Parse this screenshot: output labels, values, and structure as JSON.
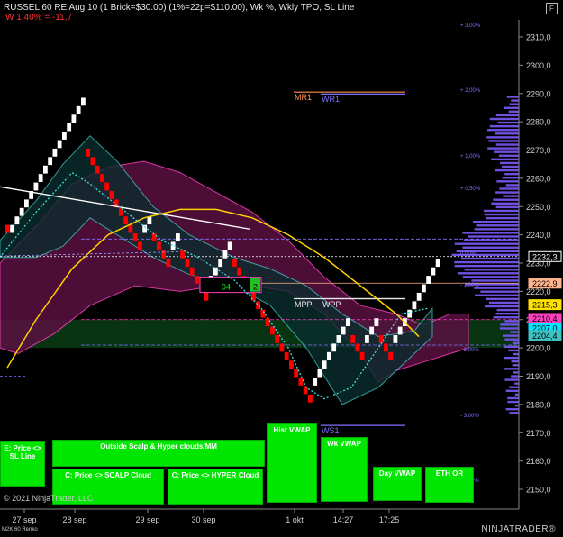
{
  "header": {
    "title": "RUSSEL 60 RE Aug 10 (1 Brick=$30.00) (1%=22p=$110.00), Wk %, Wkly TPO, SL Line",
    "subtitle": "W 1,40% = -11,7"
  },
  "copyright": "© 2021 NinjaTrader, LLC",
  "footer_left": "M2K 60 Renko",
  "brand": "NINJATRADER®",
  "colors": {
    "background": "#000000",
    "brick_up": "#ffffff",
    "brick_down": "#ff0000",
    "brick_neutral": "#a0a0a0",
    "vwap_curve": "#ffd000",
    "cloud_pink": "#ff40c0",
    "cloud_teal": "#40c0c0",
    "profile": "#7050e0",
    "button": "#00e600"
  },
  "chart_data": {
    "type": "renko",
    "y_axis": {
      "range": [
        2165,
        2316
      ],
      "ticks": [
        2150,
        2160,
        2170,
        2180,
        2190,
        2200,
        2210,
        2220,
        2230,
        2240,
        2250,
        2260,
        2270,
        2280,
        2290,
        2300,
        2310
      ],
      "tick_labels": [
        "2150,0",
        "2160,0",
        "2170,0",
        "2180,0",
        "2190,0",
        "2200,0",
        "2210,0",
        "2220,0",
        "2230,0",
        "2240,0",
        "2250,0",
        "2260,0",
        "2270,0",
        "2280,0",
        "2290,0",
        "2300,0",
        "2310,0"
      ]
    },
    "x_axis": {
      "tick_labels": [
        "27 sep",
        "28 sep",
        "29 sep",
        "30 sep",
        "1 okt",
        "14:27",
        "17:25"
      ]
    },
    "bricks": [
      {
        "dir": "down",
        "close": 2240.5
      },
      {
        "dir": "up",
        "close": 2243.5
      },
      {
        "dir": "up",
        "close": 2246.5
      },
      {
        "dir": "up",
        "close": 2249.5
      },
      {
        "dir": "up",
        "close": 2252.5
      },
      {
        "dir": "up",
        "close": 2255.5
      },
      {
        "dir": "up",
        "close": 2258.5
      },
      {
        "dir": "up",
        "close": 2261.5
      },
      {
        "dir": "up",
        "close": 2264.5
      },
      {
        "dir": "up",
        "close": 2267.5
      },
      {
        "dir": "up",
        "close": 2270.5
      },
      {
        "dir": "up",
        "close": 2273.5
      },
      {
        "dir": "up",
        "close": 2276.5
      },
      {
        "dir": "up",
        "close": 2279.5
      },
      {
        "dir": "up",
        "close": 2282.5
      },
      {
        "dir": "up",
        "close": 2285.5
      },
      {
        "dir": "up",
        "close": 2288.5
      },
      {
        "dir": "down",
        "close": 2267.5
      },
      {
        "dir": "down",
        "close": 2264.5
      },
      {
        "dir": "down",
        "close": 2261.5
      },
      {
        "dir": "down",
        "close": 2258.5
      },
      {
        "dir": "down",
        "close": 2255.5
      },
      {
        "dir": "down",
        "close": 2252.5
      },
      {
        "dir": "down",
        "close": 2249.5
      },
      {
        "dir": "down",
        "close": 2246.5
      },
      {
        "dir": "down",
        "close": 2243.5
      },
      {
        "dir": "down",
        "close": 2240.5
      },
      {
        "dir": "down",
        "close": 2237.5
      },
      {
        "dir": "down",
        "close": 2234.5
      },
      {
        "dir": "up",
        "close": 2243.5
      },
      {
        "dir": "up",
        "close": 2246.5
      },
      {
        "dir": "down",
        "close": 2237.5
      },
      {
        "dir": "down",
        "close": 2234.5
      },
      {
        "dir": "down",
        "close": 2231.5
      },
      {
        "dir": "down",
        "close": 2228.5
      },
      {
        "dir": "up",
        "close": 2237.5
      },
      {
        "dir": "up",
        "close": 2240.5
      },
      {
        "dir": "down",
        "close": 2231.5
      },
      {
        "dir": "down",
        "close": 2228.5
      },
      {
        "dir": "down",
        "close": 2225.5
      },
      {
        "dir": "down",
        "close": 2222.5
      },
      {
        "dir": "down",
        "close": 2219.5
      },
      {
        "dir": "down",
        "close": 2216.5
      },
      {
        "dir": "up",
        "close": 2225.5
      },
      {
        "dir": "up",
        "close": 2228.5
      },
      {
        "dir": "up",
        "close": 2231.5
      },
      {
        "dir": "up",
        "close": 2234.5
      },
      {
        "dir": "up",
        "close": 2237.5
      },
      {
        "dir": "down",
        "close": 2228.5
      },
      {
        "dir": "down",
        "close": 2225.5
      },
      {
        "dir": "down",
        "close": 2222.5
      },
      {
        "dir": "down",
        "close": 2219.5
      },
      {
        "dir": "down",
        "close": 2216.5
      },
      {
        "dir": "down",
        "close": 2213.5
      },
      {
        "dir": "down",
        "close": 2210.5
      },
      {
        "dir": "down",
        "close": 2207.5
      },
      {
        "dir": "down",
        "close": 2204.5
      },
      {
        "dir": "down",
        "close": 2201.5
      },
      {
        "dir": "down",
        "close": 2198.5
      },
      {
        "dir": "down",
        "close": 2195.5
      },
      {
        "dir": "down",
        "close": 2192.5
      },
      {
        "dir": "down",
        "close": 2189.5
      },
      {
        "dir": "down",
        "close": 2186.5
      },
      {
        "dir": "down",
        "close": 2183.5
      },
      {
        "dir": "down",
        "close": 2180.5
      },
      {
        "dir": "up",
        "close": 2189.5
      },
      {
        "dir": "up",
        "close": 2192.5
      },
      {
        "dir": "up",
        "close": 2195.5
      },
      {
        "dir": "up",
        "close": 2198.5
      },
      {
        "dir": "up",
        "close": 2201.5
      },
      {
        "dir": "up",
        "close": 2204.5
      },
      {
        "dir": "up",
        "close": 2207.5
      },
      {
        "dir": "up",
        "close": 2210.5
      },
      {
        "dir": "down",
        "close": 2201.5
      },
      {
        "dir": "down",
        "close": 2198.5
      },
      {
        "dir": "down",
        "close": 2195.5
      },
      {
        "dir": "up",
        "close": 2204.5
      },
      {
        "dir": "up",
        "close": 2207.5
      },
      {
        "dir": "up",
        "close": 2210.5
      },
      {
        "dir": "down",
        "close": 2201.5
      },
      {
        "dir": "down",
        "close": 2198.5
      },
      {
        "dir": "down",
        "close": 2195.5
      },
      {
        "dir": "up",
        "close": 2204.5
      },
      {
        "dir": "up",
        "close": 2207.5
      },
      {
        "dir": "up",
        "close": 2210.5
      },
      {
        "dir": "up",
        "close": 2213.5
      },
      {
        "dir": "up",
        "close": 2216.5
      },
      {
        "dir": "up",
        "close": 2219.5
      },
      {
        "dir": "up",
        "close": 2222.5
      },
      {
        "dir": "up",
        "close": 2225.5
      },
      {
        "dir": "up",
        "close": 2228.5
      },
      {
        "dir": "up",
        "close": 2231.5
      }
    ],
    "levels": [
      {
        "label": "MR1",
        "value": 2290.5,
        "color": "#ff9050"
      },
      {
        "label": "WR1",
        "value": 2289.8,
        "color": "#8070ff"
      },
      {
        "label": "MPP",
        "value": 2217.4,
        "color": "#e6e6e6"
      },
      {
        "label": "WPP",
        "value": 2217.4,
        "color": "#e6e6e6"
      },
      {
        "label": "WS1",
        "value": 2172.6,
        "color": "#8070ff"
      }
    ],
    "pct_labels": [
      {
        "label": "+ 3,00%",
        "value": 2313.0
      },
      {
        "label": "+ 2,00%",
        "value": 2290.0
      },
      {
        "label": "+ 1,00%",
        "value": 2266.8
      },
      {
        "label": "+ 0,50%",
        "value": 2255.3
      },
      {
        "label": "0,00%",
        "value": 2232.3
      },
      {
        "label": "- 1,00%",
        "value": 2221.0
      },
      {
        "label": "- 2,00%",
        "value": 2198.0
      },
      {
        "label": "- 3,00%",
        "value": 2175.0
      },
      {
        "label": "- 4,00%",
        "value": 2152.0
      }
    ],
    "price_tags": [
      {
        "label": "2232,3",
        "value": 2232.3,
        "bg": "#000000",
        "fg": "#ffffff",
        "border": "#ffffff"
      },
      {
        "label": "2222,9",
        "value": 2222.9,
        "bg": "#ffb48c",
        "fg": "#000000",
        "border": "#ffb48c"
      },
      {
        "label": "2215,3",
        "value": 2215.3,
        "bg": "#ffe000",
        "fg": "#000000",
        "border": "#ffe000"
      },
      {
        "label": "2210,4",
        "value": 2210.4,
        "bg": "#ff40c0",
        "fg": "#000000",
        "border": "#ff40c0"
      },
      {
        "label": "2207,0",
        "value": 2207.0,
        "bg": "#00e6ff",
        "fg": "#000000",
        "border": "#00e6ff"
      },
      {
        "label": "2204,4",
        "value": 2204.4,
        "bg": "#40c0c0",
        "fg": "#000000",
        "border": "#40c0c0"
      }
    ],
    "zone_box": {
      "label_left": "94",
      "label_right": "2",
      "top": 2225.0,
      "bottom": 2219.6
    }
  },
  "buttons": [
    {
      "id": "e-price-sl",
      "label": "E: Price <> SL Line"
    },
    {
      "id": "outside-scalp",
      "label": "Outside Scalp & Hyper clouds/MM"
    },
    {
      "id": "c-price-scalp",
      "label": "C: Price <> SCALP Cloud"
    },
    {
      "id": "c-price-hyper",
      "label": "C: Price <> HYPER Cloud"
    },
    {
      "id": "hist-vwap",
      "label": "Hist VWAP"
    },
    {
      "id": "wk-vwap",
      "label": "Wk VWAP"
    },
    {
      "id": "day-vwap",
      "label": "Day VWAP"
    },
    {
      "id": "eth-or",
      "label": "ETH OR"
    }
  ]
}
